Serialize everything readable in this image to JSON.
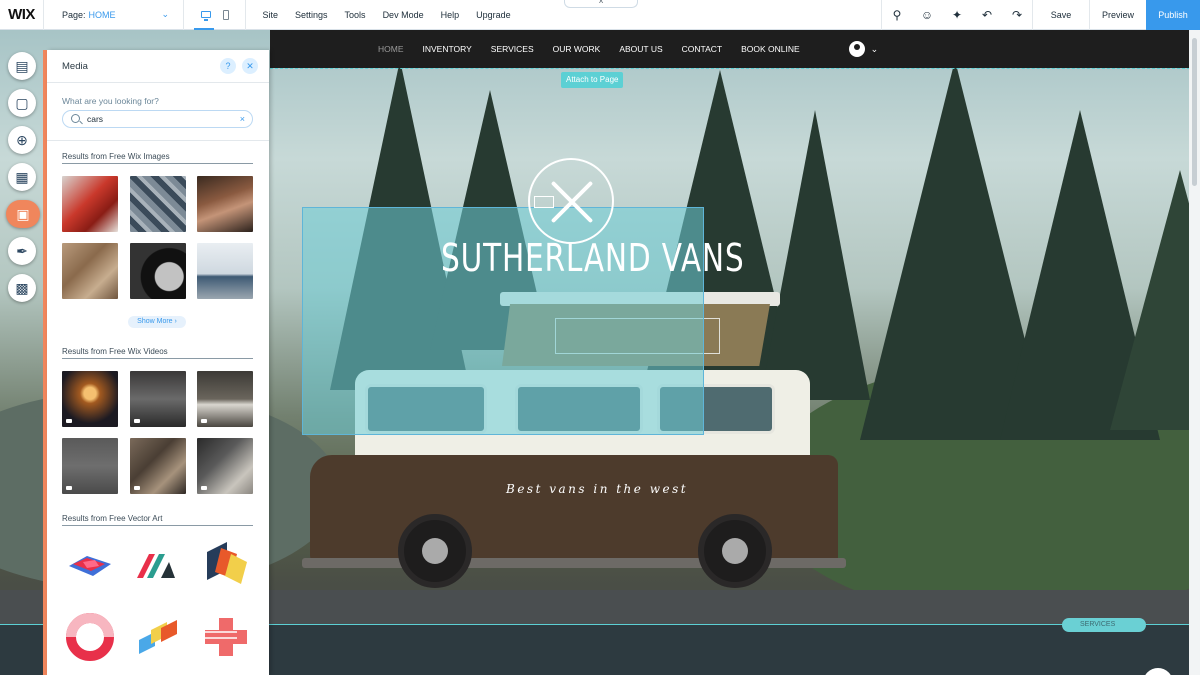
{
  "app": {
    "logo": "WIX"
  },
  "topbar": {
    "page_label": "Page:",
    "page_value": "HOME",
    "menu": [
      "Site",
      "Settings",
      "Tools",
      "Dev Mode",
      "Help",
      "Upgrade"
    ],
    "save_label": "Save",
    "preview_label": "Preview",
    "publish_label": "Publish"
  },
  "site": {
    "nav": [
      "HOME",
      "INVENTORY",
      "SERVICES",
      "OUR WORK",
      "ABOUT US",
      "CONTACT",
      "BOOK ONLINE"
    ],
    "attach_label": "Attach to Page",
    "title": "SUTHERLAND VANS",
    "tagline": "Best vans in the west",
    "services_badge": "SERVICES"
  },
  "left_toolbar": {
    "items": [
      "pages-icon",
      "background-icon",
      "add-icon",
      "app-market-icon",
      "media-icon",
      "blog-icon",
      "bookings-icon"
    ],
    "active": "media-icon"
  },
  "media_panel": {
    "title": "Media",
    "search_label": "What are you looking for?",
    "search_value": "cars",
    "section_images": "Results from Free Wix Images",
    "show_more": "Show More",
    "section_videos": "Results from Free Wix Videos",
    "section_vector": "Results from Free Vector Art"
  },
  "colors": {
    "accent": "#3899ec",
    "active_tool": "#f0865c",
    "selection": "#5cd0d4"
  }
}
